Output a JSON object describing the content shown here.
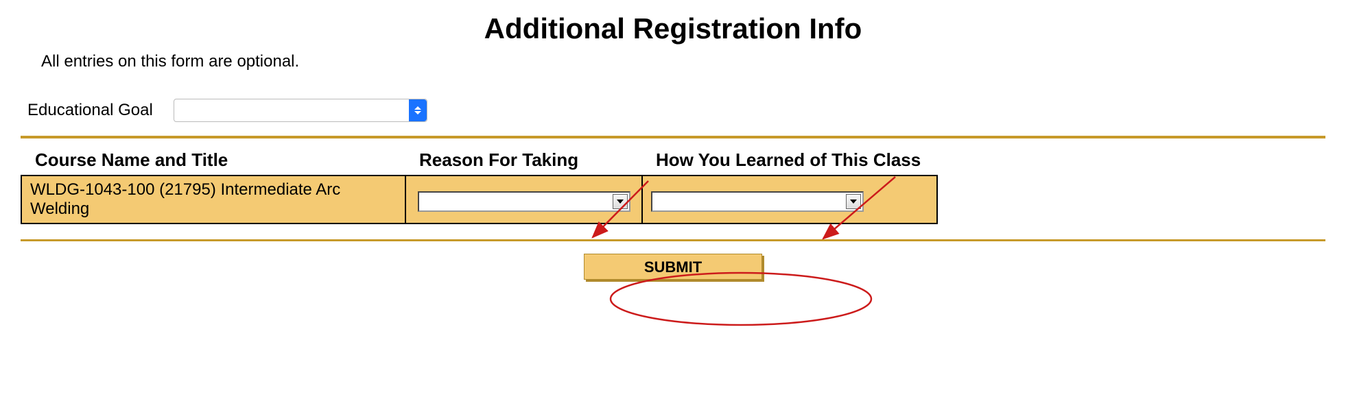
{
  "page": {
    "title": "Additional Registration Info",
    "subtext": "All entries on this form are optional."
  },
  "goal": {
    "label": "Educational Goal",
    "value": ""
  },
  "table": {
    "headers": {
      "course": "Course Name and Title",
      "reason": "Reason For Taking",
      "learned": "How You Learned of This Class"
    },
    "rows": [
      {
        "course": "WLDG-1043-100 (21795) Intermediate Arc Welding",
        "reason": "",
        "learned": ""
      }
    ]
  },
  "buttons": {
    "submit": "SUBMIT"
  }
}
